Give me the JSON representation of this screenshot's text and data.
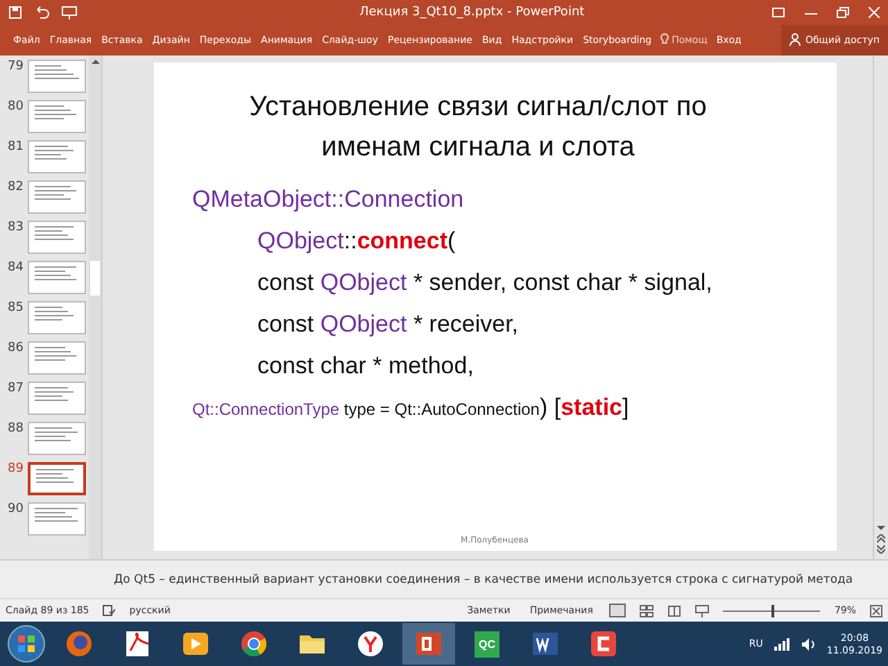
{
  "window": {
    "title": "Лекция 3_Qt10_8.pptx - PowerPoint"
  },
  "ribbon": {
    "tabs": [
      {
        "label": "Файл",
        "selected": false
      },
      {
        "label": "Главная",
        "selected": false
      },
      {
        "label": "Вставка",
        "selected": false
      },
      {
        "label": "Дизайн",
        "selected": false
      },
      {
        "label": "Переходы",
        "selected": false
      },
      {
        "label": "Анимация",
        "selected": false
      },
      {
        "label": "Слайд-шоу",
        "selected": false
      },
      {
        "label": "Рецензирование",
        "selected": false
      },
      {
        "label": "Вид",
        "selected": false
      },
      {
        "label": "Надстройки",
        "selected": false
      },
      {
        "label": "Storyboarding",
        "selected": false
      }
    ],
    "help": "Помощ",
    "sign_in": "Вход",
    "share": "Общий доступ"
  },
  "thumbnails": [
    {
      "number": "79",
      "selected": false
    },
    {
      "number": "80",
      "selected": false
    },
    {
      "number": "81",
      "selected": false
    },
    {
      "number": "82",
      "selected": false
    },
    {
      "number": "83",
      "selected": false
    },
    {
      "number": "84",
      "selected": false
    },
    {
      "number": "85",
      "selected": false
    },
    {
      "number": "86",
      "selected": false
    },
    {
      "number": "87",
      "selected": false
    },
    {
      "number": "88",
      "selected": false
    },
    {
      "number": "89",
      "selected": true
    },
    {
      "number": "90",
      "selected": false
    }
  ],
  "slide": {
    "title": "Установление связи сигнал/слот по именам сигнала и слота",
    "lines": [
      {
        "indented": false,
        "segments": [
          {
            "kind": "type",
            "text": "QMetaObject::Connection"
          }
        ]
      },
      {
        "indented": true,
        "segments": [
          {
            "kind": "type",
            "text": "QObject"
          },
          {
            "kind": "text",
            "text": "::"
          },
          {
            "kind": "keyword",
            "text": "connect"
          },
          {
            "kind": "text",
            "text": "("
          }
        ]
      },
      {
        "indented": true,
        "segments": [
          {
            "kind": "text",
            "text": "const "
          },
          {
            "kind": "type",
            "text": "QObject"
          },
          {
            "kind": "text",
            "text": " * sender, const char * signal,"
          }
        ]
      },
      {
        "indented": true,
        "segments": [
          {
            "kind": "text",
            "text": "const "
          },
          {
            "kind": "type",
            "text": "QObject"
          },
          {
            "kind": "text",
            "text": " * receiver,"
          }
        ]
      },
      {
        "indented": true,
        "segments": [
          {
            "kind": "text",
            "text": "const char * method,"
          }
        ]
      },
      {
        "indented": false,
        "segments": [
          {
            "kind": "type-small",
            "text": "Qt::ConnectionType"
          },
          {
            "kind": "text-small",
            "text": " type = Qt::AutoConnection"
          },
          {
            "kind": "text",
            "text": ") ["
          },
          {
            "kind": "keyword",
            "text": "static"
          },
          {
            "kind": "text",
            "text": "]"
          }
        ]
      }
    ],
    "footer": "М.Полубенцева"
  },
  "notes": "До Qt5 – единственный вариант установки соединения – в качестве имени используется строка с сигнатурой метода",
  "status_bar": {
    "slide": "Слайд 89 из 185",
    "language": "русский",
    "notes": "Заметки",
    "comments": "Примечания",
    "zoom": {
      "level": 0.5
    },
    "zoom_text": "79%"
  },
  "taskbar": {
    "apps": [
      {
        "kind": "firefox",
        "selected": false
      },
      {
        "kind": "pdf",
        "selected": false
      },
      {
        "kind": "player",
        "selected": false
      },
      {
        "kind": "chrome",
        "selected": false
      },
      {
        "kind": "folder",
        "selected": false
      },
      {
        "kind": "yandex",
        "selected": false
      },
      {
        "kind": "powerpoint",
        "selected": true
      },
      {
        "kind": "qc",
        "selected": false
      },
      {
        "kind": "word",
        "selected": false
      },
      {
        "kind": "camtasia",
        "selected": false
      }
    ],
    "qc_label": "QC",
    "language": "RU",
    "time": "20:08",
    "date": "11.09.2019"
  }
}
